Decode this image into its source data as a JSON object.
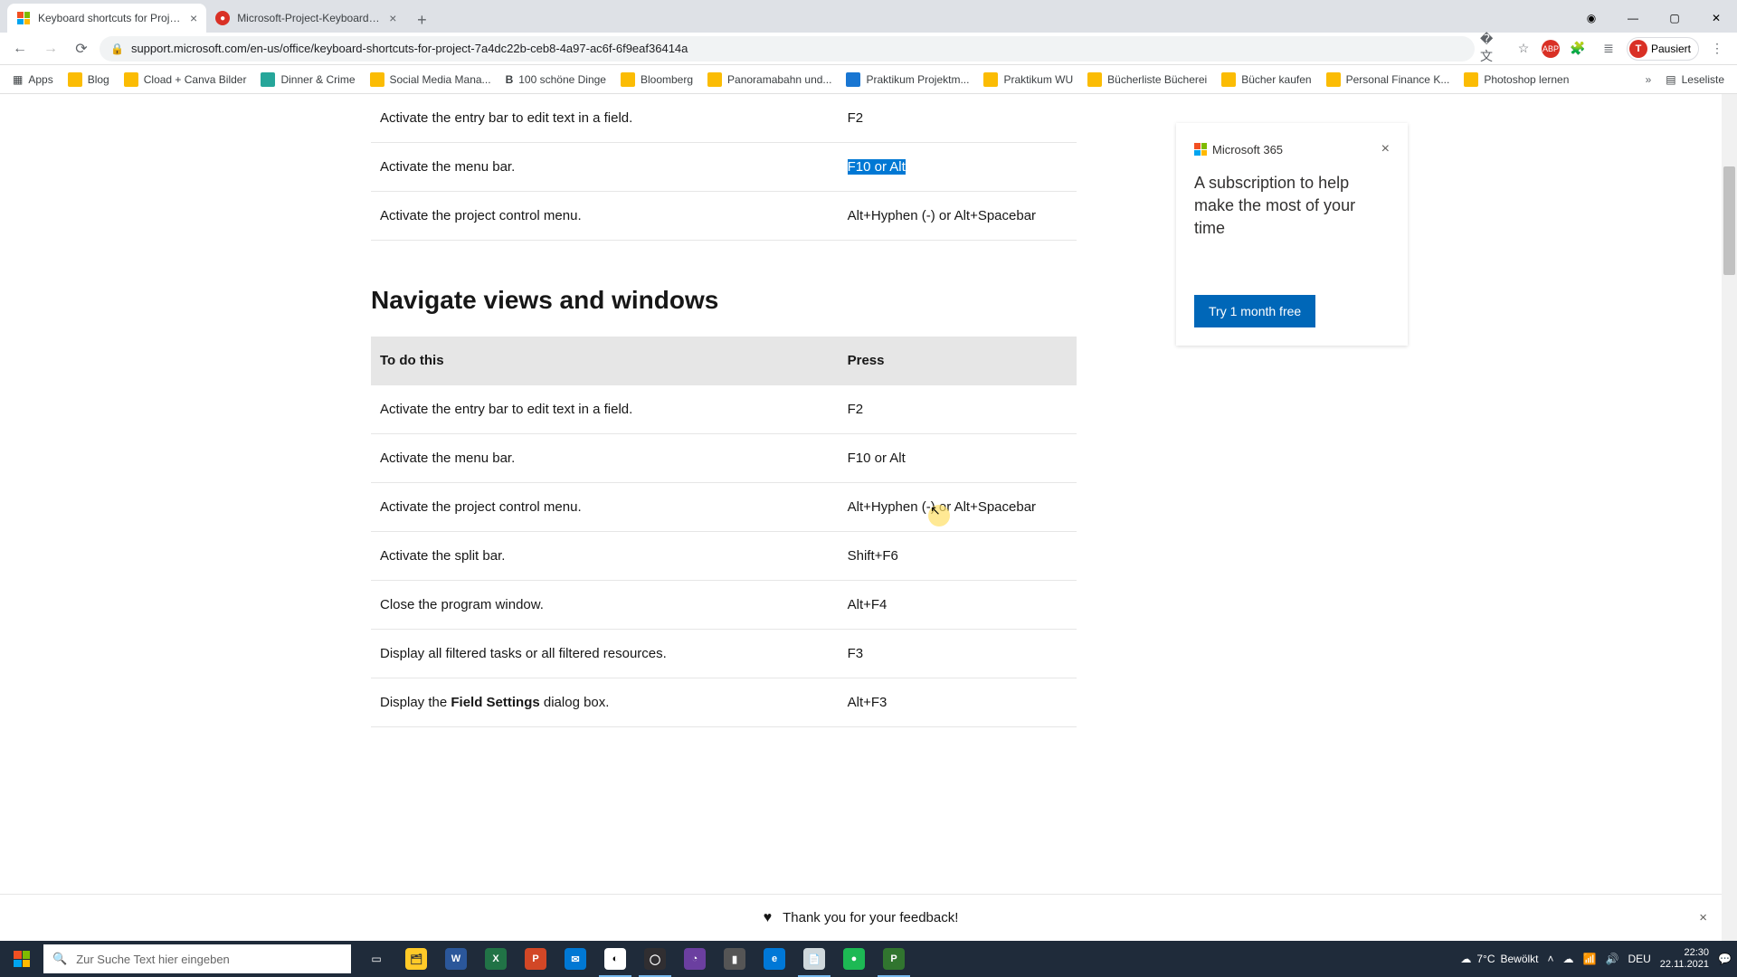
{
  "browser": {
    "tabs": [
      {
        "title": "Keyboard shortcuts for Project",
        "active": true
      },
      {
        "title": "Microsoft-Project-Keyboard-Sh",
        "active": false
      }
    ],
    "url": "support.microsoft.com/en-us/office/keyboard-shortcuts-for-project-7a4dc22b-ceb8-4a97-ac6f-6f9eaf36414a",
    "profile_status": "Pausiert",
    "profile_initial": "T"
  },
  "bookmarks": [
    "Apps",
    "Blog",
    "Cload + Canva Bilder",
    "Dinner & Crime",
    "Social Media Mana...",
    "100 schöne Dinge",
    "Bloomberg",
    "Panoramabahn und...",
    "Praktikum Projektm...",
    "Praktikum WU",
    "Bücherliste Bücherei",
    "Bücher kaufen",
    "Personal Finance K...",
    "Photoshop lernen"
  ],
  "bookbar_tail": "Leseliste",
  "top_table": {
    "rows": [
      {
        "action": "Activate the entry bar to edit text in a field.",
        "press": "F2",
        "selected": false
      },
      {
        "action": "Activate the menu bar.",
        "press": "F10 or Alt",
        "selected": true
      },
      {
        "action": "Activate the project control menu.",
        "press": "Alt+Hyphen (-) or Alt+Spacebar",
        "selected": false
      }
    ]
  },
  "section_heading": "Navigate views and windows",
  "main_table": {
    "headers": {
      "action": "To do this",
      "press": "Press"
    },
    "rows": [
      {
        "action": "Activate the entry bar to edit text in a field.",
        "press": "F2"
      },
      {
        "action": "Activate the menu bar.",
        "press": "F10 or Alt"
      },
      {
        "action": "Activate the project control menu.",
        "press": "Alt+Hyphen (-) or Alt+Spacebar"
      },
      {
        "action": "Activate the split bar.",
        "press": "Shift+F6"
      },
      {
        "action": "Close the program window.",
        "press": "Alt+F4"
      },
      {
        "action": "Display all filtered tasks or all filtered resources.",
        "press": "F3"
      },
      {
        "action_pre": "Display the ",
        "action_bold": "Field Settings",
        "action_post": " dialog box.",
        "press": "Alt+F3"
      }
    ]
  },
  "promo": {
    "brand": "Microsoft 365",
    "text": "A subscription to help make the most of your time",
    "cta": "Try 1 month free"
  },
  "feedback": "Thank you for your feedback!",
  "taskbar": {
    "search_placeholder": "Zur Suche Text hier eingeben",
    "weather_temp": "7°C",
    "weather_label": "Bewölkt",
    "lang": "DEU",
    "time": "22:30",
    "date": "22.11.2021"
  }
}
